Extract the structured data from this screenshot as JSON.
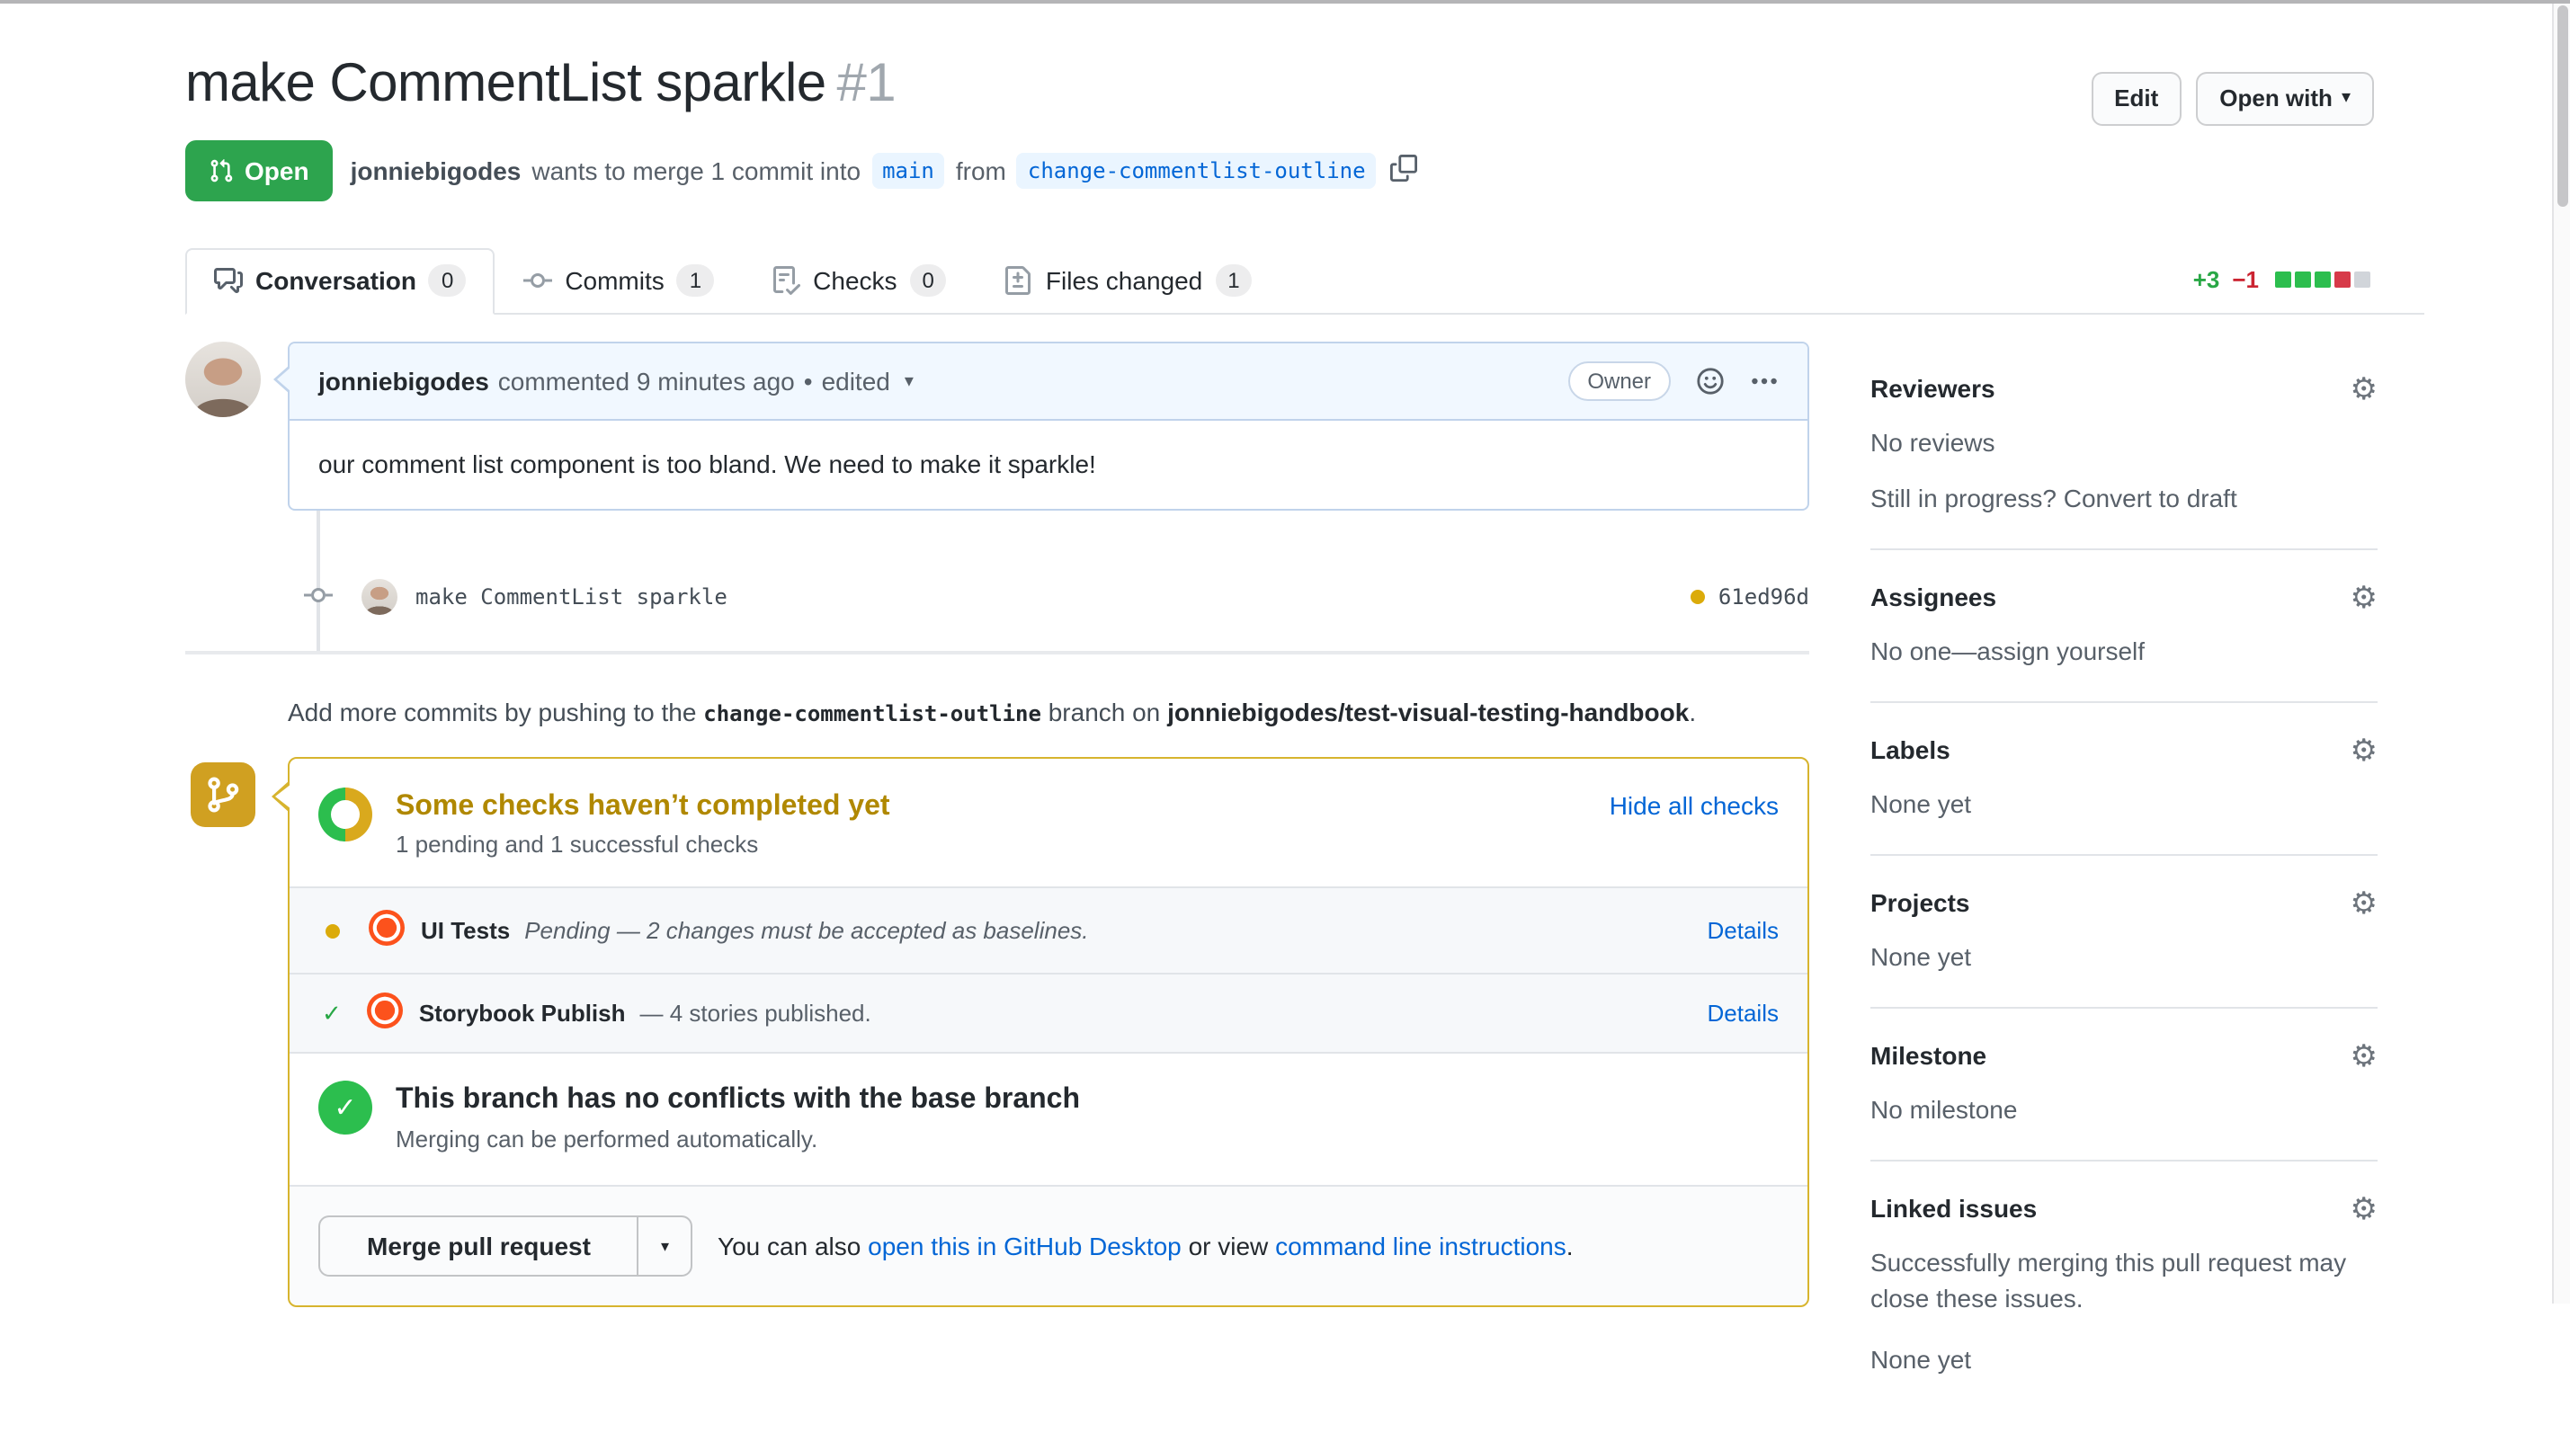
{
  "page": {
    "title": "make CommentList sparkle",
    "number": "#1"
  },
  "header": {
    "edit_button": "Edit",
    "open_with_button": "Open with",
    "state_badge": "Open",
    "byline": {
      "author": "jonniebigodes",
      "action": "wants to merge 1 commit into",
      "base_branch": "main",
      "from_word": "from",
      "head_branch": "change-commentlist-outline"
    }
  },
  "tabs": [
    {
      "label": "Conversation",
      "count": "0"
    },
    {
      "label": "Commits",
      "count": "1"
    },
    {
      "label": "Checks",
      "count": "0"
    },
    {
      "label": "Files changed",
      "count": "1"
    }
  ],
  "diffstat": {
    "additions": "+3",
    "deletions": "−1"
  },
  "conversation": {
    "comment": {
      "author": "jonniebigodes",
      "meta": "commented 9 minutes ago",
      "separator": "•",
      "edited_label": "edited",
      "owner_badge": "Owner",
      "body": "our comment list component is too bland. We need to make it sparkle!"
    },
    "commit": {
      "message": "make CommentList sparkle",
      "sha": "61ed96d"
    },
    "push_hint": {
      "prefix": "Add more commits by pushing to the",
      "branch": "change-commentlist-outline",
      "middle": "branch on",
      "repo": "jonniebigodes/test-visual-testing-handbook",
      "suffix": "."
    }
  },
  "checks": {
    "title": "Some checks haven’t completed yet",
    "subtitle": "1 pending and 1 successful checks",
    "hide_link": "Hide all checks",
    "rows": [
      {
        "name": "UI Tests",
        "status": "Pending — 2 changes must be accepted as baselines.",
        "details_link": "Details"
      },
      {
        "name": "Storybook Publish",
        "status": "— 4 stories published.",
        "details_link": "Details"
      }
    ],
    "mergeability": {
      "title": "This branch has no conflicts with the base branch",
      "subtitle": "Merging can be performed automatically."
    },
    "merge": {
      "button": "Merge pull request",
      "caption_prefix": "You can also",
      "desktop_link": "open this in GitHub Desktop",
      "caption_middle": "or view",
      "cli_link": "command line instructions",
      "caption_suffix": "."
    }
  },
  "sidebar": {
    "sections": [
      {
        "heading": "Reviewers",
        "line1": "No reviews",
        "line2": "Still in progress? Convert to draft"
      },
      {
        "heading": "Assignees",
        "line1": "No one—assign yourself"
      },
      {
        "heading": "Labels",
        "line1": "None yet"
      },
      {
        "heading": "Projects",
        "line1": "None yet"
      },
      {
        "heading": "Milestone",
        "line1": "No milestone"
      },
      {
        "heading": "Linked issues",
        "line1": "Successfully merging this pull request may close these issues.",
        "line2": "None yet"
      }
    ]
  },
  "glyphs": {
    "caret_down": "▾",
    "gear": "⚙",
    "check": "✓"
  },
  "colors": {
    "open_green": "#2da44e",
    "warning_text": "#b08800",
    "warning_border": "#d7b42e",
    "link_blue": "#0366d6",
    "addition_green": "#28a745",
    "deletion_red": "#cb2431",
    "pending_yellow": "#dbab0a",
    "chromatic_orange": "#fc521c",
    "success_green": "#2cbe4e"
  }
}
